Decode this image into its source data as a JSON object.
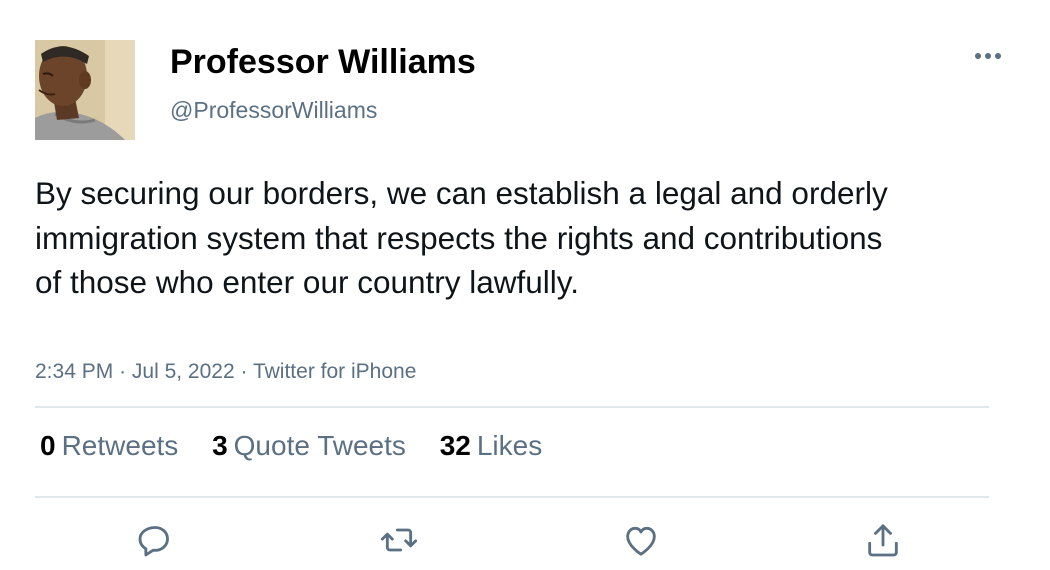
{
  "user": {
    "display_name": "Professor Williams",
    "handle": "@ProfessorWilliams",
    "avatar_icon": "profile-photo"
  },
  "tweet": {
    "text": "By securing our borders, we can establish a legal and orderly immigration system that respects the rights and contributions of those who enter our country lawfully.",
    "time": "2:34 PM",
    "date": "Jul 5, 2022",
    "source": "Twitter for iPhone",
    "separator": "·"
  },
  "stats": {
    "retweets": {
      "count": "0",
      "label": "Retweets"
    },
    "quotes": {
      "count": "3",
      "label": "Quote Tweets"
    },
    "likes": {
      "count": "32",
      "label": "Likes"
    }
  },
  "actions": [
    "reply-icon",
    "retweet-icon",
    "like-icon",
    "share-icon"
  ],
  "colors": {
    "text": "#0f1419",
    "secondary": "#5b7083",
    "divider": "#e1e8ed"
  }
}
